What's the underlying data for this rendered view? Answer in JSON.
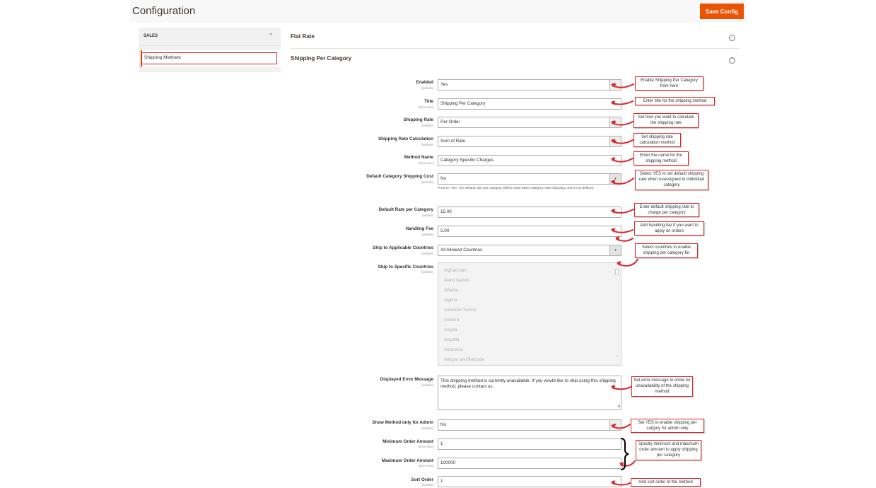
{
  "header": {
    "title": "Configuration",
    "save_label": "Save Config",
    "accent_color": "#eb5202"
  },
  "sidebar": {
    "section_label": "SALES",
    "collapse_icon": "chevron-up-icon",
    "items": [
      {
        "label": "Shipping Methods"
      }
    ]
  },
  "sections": [
    {
      "title": "Flat Rate",
      "toggle_icon": "circle-chevron-down-icon"
    },
    {
      "title": "Shipping Per Category",
      "toggle_icon": "circle-chevron-up-icon"
    }
  ],
  "form": {
    "enabled": {
      "label": "Enabled",
      "scope": "[website]",
      "value": "Yes"
    },
    "title": {
      "label": "Title",
      "scope": "[store view]",
      "value": "Shipping Per Category"
    },
    "shipping_rate": {
      "label": "Shipping Rate",
      "scope": "[website]",
      "value": "Per Order"
    },
    "rate_calculation": {
      "label": "Shipping Rate Calculation",
      "scope": "[website]",
      "value": "Sum of Rate"
    },
    "method_name": {
      "label": "Method Name",
      "scope": "[store view]",
      "value": "Category Specific Charges"
    },
    "default_category_cost": {
      "label": "Default Category Shipping Cost",
      "scope": "[website]",
      "value": "No",
      "note": "If set to \"Yes\", the default rate per category will be used when category wise shipping cost is not defined."
    },
    "default_rate": {
      "label": "Default Rate per Category",
      "scope": "[website]",
      "value": "15.00"
    },
    "handling_fee": {
      "label": "Handling Fee",
      "scope": "[website]",
      "value": "5.00"
    },
    "applicable_countries": {
      "label": "Ship to Applicable Countries",
      "scope": "[website]",
      "value": "All Allowed Countries"
    },
    "specific_countries": {
      "label": "Ship to Specific Countries",
      "scope": "[website]",
      "options": [
        "Afghanistan",
        "Åland Islands",
        "Albania",
        "Algeria",
        "American Samoa",
        "Andorra",
        "Angola",
        "Anguilla",
        "Antarctica",
        "Antigua and Barbuda"
      ]
    },
    "error_message": {
      "label": "Displayed Error Message",
      "scope": "[website]",
      "value": "This shipping method is currently unavailable. If you would like to ship using this shipping method, please contact us."
    },
    "admin_only": {
      "label": "Show Method only for Admin",
      "scope": "[website]",
      "value": "No"
    },
    "min_order": {
      "label": "Minimum Order Amount",
      "scope": "[store view]",
      "value": "1"
    },
    "max_order": {
      "label": "Maximum Order Amount",
      "scope": "[store view]",
      "value": "100000"
    },
    "sort_order": {
      "label": "Sort Order",
      "scope": "[website]",
      "value": "1"
    }
  },
  "callouts": {
    "enabled": "Enable Shipping Per Category from here",
    "title": "Enter title for the shipping method",
    "shipping_rate": "Set how you want to calculate the shipping rate",
    "rate_calculation": "Set shipping rate calculation method",
    "method_name": "Enter the name for the shipping method",
    "default_category_cost": "Select YES to set default shipping rate when unassigned to individual category",
    "default_rate": "Enter default shipping rate to charge per category",
    "handling_fee": "Add handling fee If you want to apply on orders",
    "countries": "Select countries to enable shipping per category for",
    "error_message": "Set error message to show for unavailability of the shipping method",
    "admin_only": "Set YES to enable shipping per catgory for admin only",
    "order_amount": "Specify minimum and maximum order amount to apply shipping per category",
    "sort_order": "Add sort order of the method",
    "callout_color": "#d9262c"
  }
}
